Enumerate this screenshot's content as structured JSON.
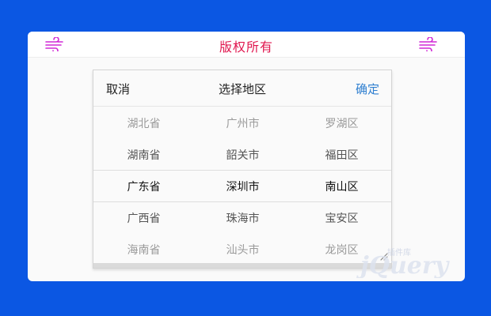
{
  "header": {
    "title": "版权所有",
    "left_icon": "wind-icon",
    "right_icon": "wind-icon",
    "title_color": "#e0174f",
    "icon_color": "#d128d6"
  },
  "picker": {
    "cancel_label": "取消",
    "title": "选择地区",
    "confirm_label": "确定",
    "confirm_color": "#2f7fd0",
    "columns": {
      "province": [
        "湖北省",
        "湖南省",
        "广东省",
        "广西省",
        "海南省"
      ],
      "city": [
        "广州市",
        "韶关市",
        "深圳市",
        "珠海市",
        "汕头市"
      ],
      "district": [
        "罗湖区",
        "福田区",
        "南山区",
        "宝安区",
        "龙岗区"
      ]
    },
    "selected": {
      "province": "广东省",
      "city": "深圳市",
      "district": "南山区"
    }
  },
  "background_color": "#0b57e3",
  "watermark": {
    "text": "插件库",
    "brand": "jQuery"
  }
}
